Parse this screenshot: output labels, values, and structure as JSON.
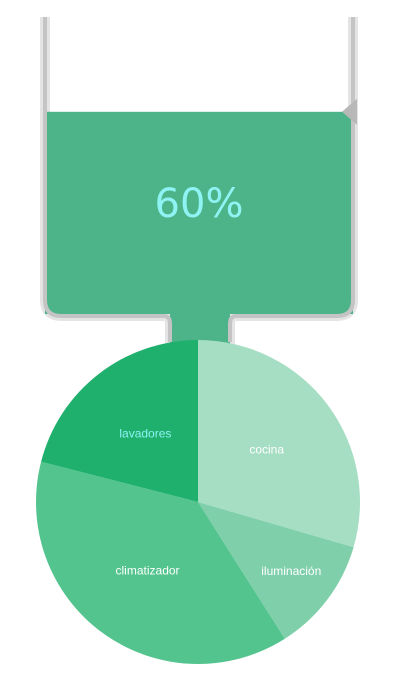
{
  "chart_data": [
    {
      "type": "gauge",
      "value": 0.6,
      "label": "60%",
      "colors": {
        "fill": "#4db48a",
        "frame": "#c4c4c4",
        "label": "#8ff3f3"
      }
    },
    {
      "type": "pie",
      "start_angle_deg": 0,
      "direction": "clockwise",
      "slices": [
        {
          "label": "cocina",
          "value": 29.5,
          "color": "#a6dec3",
          "label_color": "#ffffff"
        },
        {
          "label": "iluminación",
          "value": 11.5,
          "color": "#7fcfaa",
          "label_color": "#ffffff"
        },
        {
          "label": "climatizador",
          "value": 38.0,
          "color": "#53c48e",
          "label_color": "#ffffff"
        },
        {
          "label": "lavadores",
          "value": 21.0,
          "color": "#1fb06e",
          "label_color": "#8ff3f3"
        }
      ]
    }
  ]
}
